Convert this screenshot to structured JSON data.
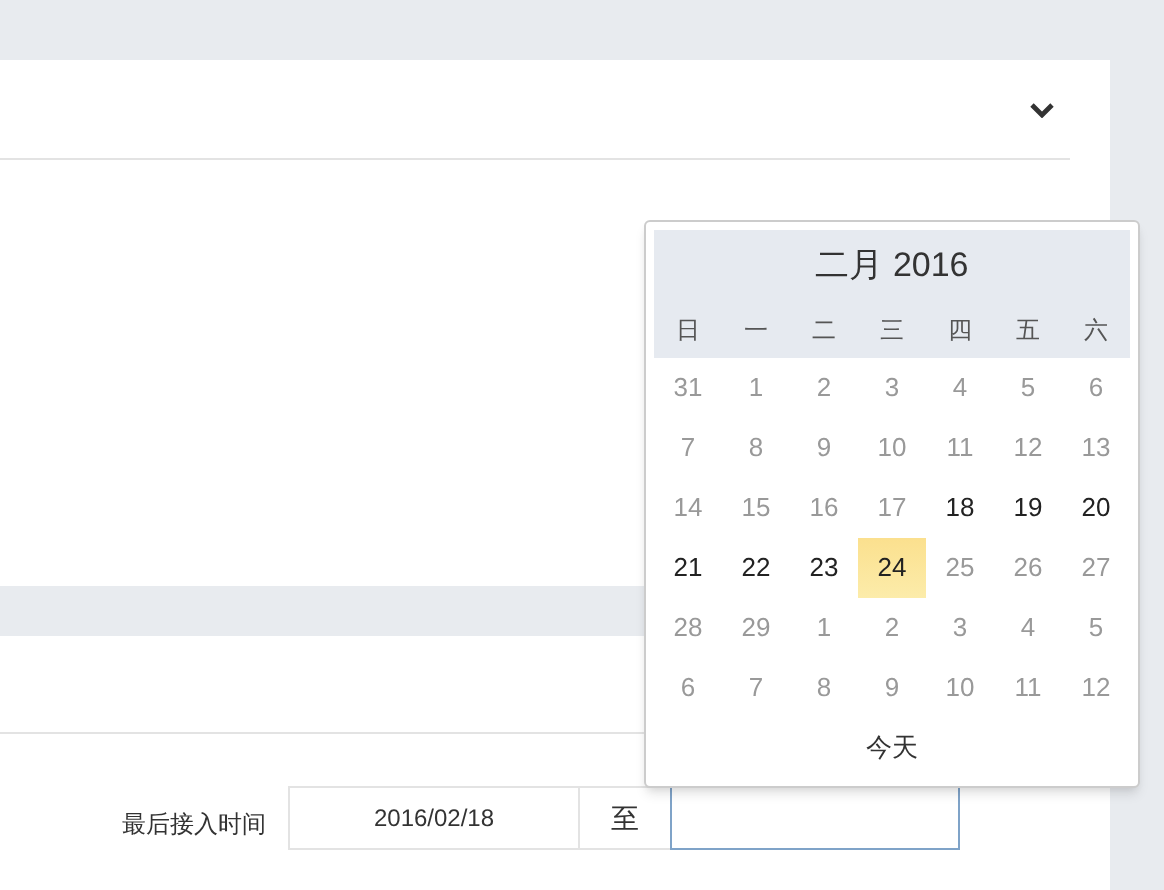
{
  "filter": {
    "label": "最后接入时间",
    "start_value": "2016/02/18",
    "separator": "至"
  },
  "calendar": {
    "title": "二月 2016",
    "weekdays": [
      "日",
      "一",
      "二",
      "三",
      "四",
      "五",
      "六"
    ],
    "weeks": [
      [
        {
          "label": "31",
          "disabled": true,
          "selected": false
        },
        {
          "label": "1",
          "disabled": true,
          "selected": false
        },
        {
          "label": "2",
          "disabled": true,
          "selected": false
        },
        {
          "label": "3",
          "disabled": true,
          "selected": false
        },
        {
          "label": "4",
          "disabled": true,
          "selected": false
        },
        {
          "label": "5",
          "disabled": true,
          "selected": false
        },
        {
          "label": "6",
          "disabled": true,
          "selected": false
        }
      ],
      [
        {
          "label": "7",
          "disabled": true,
          "selected": false
        },
        {
          "label": "8",
          "disabled": true,
          "selected": false
        },
        {
          "label": "9",
          "disabled": true,
          "selected": false
        },
        {
          "label": "10",
          "disabled": true,
          "selected": false
        },
        {
          "label": "11",
          "disabled": true,
          "selected": false
        },
        {
          "label": "12",
          "disabled": true,
          "selected": false
        },
        {
          "label": "13",
          "disabled": true,
          "selected": false
        }
      ],
      [
        {
          "label": "14",
          "disabled": true,
          "selected": false
        },
        {
          "label": "15",
          "disabled": true,
          "selected": false
        },
        {
          "label": "16",
          "disabled": true,
          "selected": false
        },
        {
          "label": "17",
          "disabled": true,
          "selected": false
        },
        {
          "label": "18",
          "disabled": false,
          "selected": false
        },
        {
          "label": "19",
          "disabled": false,
          "selected": false
        },
        {
          "label": "20",
          "disabled": false,
          "selected": false
        }
      ],
      [
        {
          "label": "21",
          "disabled": false,
          "selected": false
        },
        {
          "label": "22",
          "disabled": false,
          "selected": false
        },
        {
          "label": "23",
          "disabled": false,
          "selected": false
        },
        {
          "label": "24",
          "disabled": false,
          "selected": true
        },
        {
          "label": "25",
          "disabled": true,
          "selected": false
        },
        {
          "label": "26",
          "disabled": true,
          "selected": false
        },
        {
          "label": "27",
          "disabled": true,
          "selected": false
        }
      ],
      [
        {
          "label": "28",
          "disabled": true,
          "selected": false
        },
        {
          "label": "29",
          "disabled": true,
          "selected": false
        },
        {
          "label": "1",
          "disabled": true,
          "selected": false
        },
        {
          "label": "2",
          "disabled": true,
          "selected": false
        },
        {
          "label": "3",
          "disabled": true,
          "selected": false
        },
        {
          "label": "4",
          "disabled": true,
          "selected": false
        },
        {
          "label": "5",
          "disabled": true,
          "selected": false
        }
      ],
      [
        {
          "label": "6",
          "disabled": true,
          "selected": false
        },
        {
          "label": "7",
          "disabled": true,
          "selected": false
        },
        {
          "label": "8",
          "disabled": true,
          "selected": false
        },
        {
          "label": "9",
          "disabled": true,
          "selected": false
        },
        {
          "label": "10",
          "disabled": true,
          "selected": false
        },
        {
          "label": "11",
          "disabled": true,
          "selected": false
        },
        {
          "label": "12",
          "disabled": true,
          "selected": false
        }
      ]
    ],
    "today_button": "今天"
  }
}
